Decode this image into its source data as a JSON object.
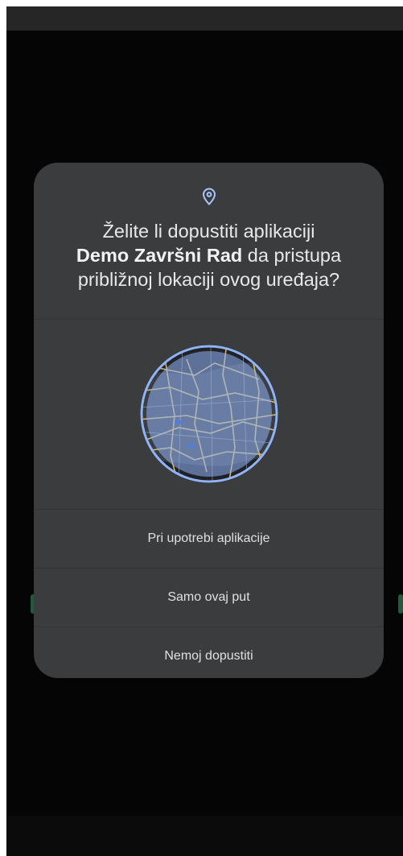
{
  "dialog": {
    "title_prefix": "Želite li dopustiti aplikaciji",
    "app_name": "Demo Završni Rad",
    "title_suffix": "da pristupa približnoj lokaciji ovog uređaja?",
    "icons": {
      "header": "location-pin-icon",
      "illustration": "approximate-location-map-illustration"
    },
    "options": [
      "Pri upotrebi aplikacije",
      "Samo ovaj put",
      "Nemoj dopustiti"
    ]
  },
  "colors": {
    "dialog_bg": "#3b3c3e",
    "map_accent": "#8fb3f5",
    "road": "#e8c870"
  }
}
